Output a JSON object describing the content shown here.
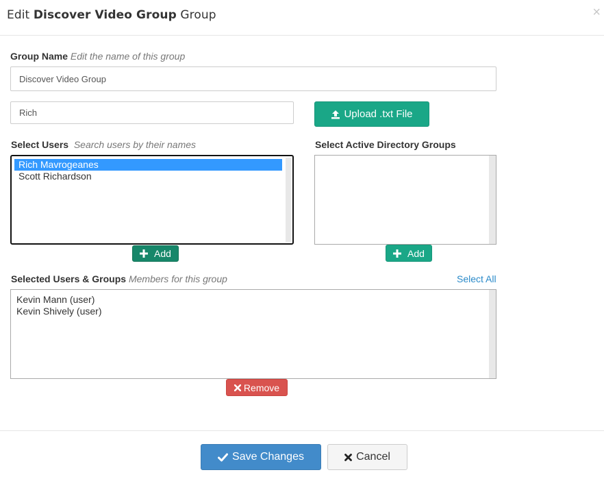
{
  "header": {
    "title_prefix": "Edit",
    "group_name": "Discover Video Group",
    "title_suffix": "Group",
    "close_symbol": "×"
  },
  "group_name_field": {
    "label": "Group Name",
    "hint": "Edit the name of this group",
    "value": "Discover Video Group"
  },
  "user_search": {
    "value": "Rich"
  },
  "upload_button": {
    "label": "Upload .txt File",
    "icon": "upload-icon"
  },
  "select_users": {
    "label": "Select Users",
    "hint": "Search users by their names",
    "options": [
      "Rich Mavrogeanes",
      "Scott Richardson"
    ],
    "selected": "Rich Mavrogeanes",
    "add_label": "Add"
  },
  "ad_groups": {
    "label": "Select Active Directory Groups",
    "options": [],
    "add_label": "Add"
  },
  "selected_members": {
    "label": "Selected Users & Groups",
    "hint": "Members for this group",
    "select_all_label": "Select All",
    "items": [
      "Kevin Mann (user)",
      "Kevin Shively (user)"
    ],
    "remove_label": "Remove"
  },
  "footer": {
    "save_label": "Save Changes",
    "cancel_label": "Cancel"
  },
  "colors": {
    "teal": "#1aa787",
    "teal_dark": "#17876a",
    "danger": "#d9534f",
    "primary": "#428bca",
    "selection": "#3399ff",
    "link": "#2a8ac9"
  }
}
